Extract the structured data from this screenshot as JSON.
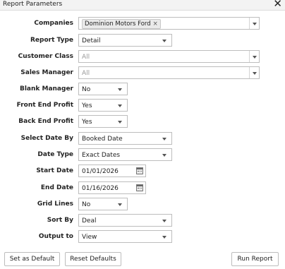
{
  "dialog": {
    "title": "Report Parameters",
    "close_glyph": "✕"
  },
  "fields": {
    "companies": {
      "label": "Companies",
      "tag": "Dominion Motors Ford",
      "tag_remove": "×"
    },
    "report_type": {
      "label": "Report Type",
      "value": "Detail"
    },
    "customer_class": {
      "label": "Customer Class",
      "placeholder": "All"
    },
    "sales_manager": {
      "label": "Sales Manager",
      "placeholder": "All"
    },
    "blank_manager": {
      "label": "Blank Manager",
      "value": "No"
    },
    "front_end_profit": {
      "label": "Front End Profit",
      "value": "Yes"
    },
    "back_end_profit": {
      "label": "Back End Profit",
      "value": "Yes"
    },
    "select_date_by": {
      "label": "Select Date By",
      "value": "Booked Date"
    },
    "date_type": {
      "label": "Date Type",
      "value": "Exact Dates"
    },
    "start_date": {
      "label": "Start Date",
      "value": "01/01/2026"
    },
    "end_date": {
      "label": "End Date",
      "value": "01/16/2026"
    },
    "grid_lines": {
      "label": "Grid Lines",
      "value": "No"
    },
    "sort_by": {
      "label": "Sort By",
      "value": "Deal"
    },
    "output_to": {
      "label": "Output to",
      "value": "View"
    }
  },
  "buttons": {
    "set_default": "Set as Default",
    "reset_defaults": "Reset Defaults",
    "run_report": "Run Report"
  },
  "icons": {
    "close": "close-icon",
    "dropdown": "chevron-down-icon",
    "calendar": "calendar-icon",
    "tag_remove": "remove-tag-icon"
  }
}
